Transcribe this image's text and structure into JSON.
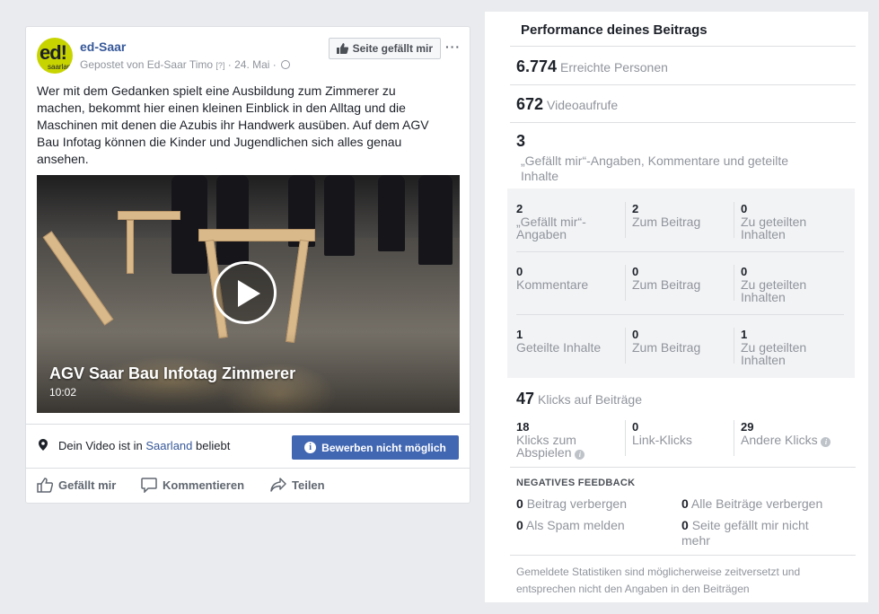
{
  "post": {
    "page_name": "ed-Saar",
    "avatar_text": "ed!",
    "avatar_sub": "saarland",
    "posted_by": "Gepostet von Ed-Saar Timo",
    "help_mark": "[?]",
    "date": "· 24. Mai ·",
    "like_page_button": "Seite gefällt mir",
    "more": "···",
    "text": "Wer mit dem Gedanken spielt eine Ausbildung zum Zimmerer zu machen, bekommt hier einen kleinen Einblick in den Alltag und die Maschinen mit denen die Azubis ihr Handwerk ausüben. Auf dem AGV Bau Infotag können die Kinder und Jugendlichen sich alles genau ansehen.",
    "video": {
      "title": "AGV Saar Bau Infotag Zimmerer",
      "duration": "10:02"
    },
    "promo": {
      "text_before": "Dein Video ist in",
      "highlight": "Saarland",
      "text_after": "beliebt",
      "button": "Bewerben nicht möglich"
    },
    "actions": {
      "like": "Gefällt mir",
      "comment": "Kommentieren",
      "share": "Teilen"
    }
  },
  "performance": {
    "title": "Performance deines Beitrags",
    "reach": {
      "value": "6.774",
      "label": "Erreichte Personen"
    },
    "views": {
      "value": "672",
      "label": "Videoaufrufe"
    },
    "reactions": {
      "value": "3",
      "label": "„Gefällt mir“-Angaben, Kommentare und geteilte Inhalte"
    },
    "grid": [
      [
        {
          "value": "2",
          "label": "„Gefällt mir“-Angaben"
        },
        {
          "value": "2",
          "label": "Zum Beitrag"
        },
        {
          "value": "0",
          "label": "Zu geteilten Inhalten"
        }
      ],
      [
        {
          "value": "0",
          "label": "Kommentare"
        },
        {
          "value": "0",
          "label": "Zum Beitrag"
        },
        {
          "value": "0",
          "label": "Zu geteilten Inhalten"
        }
      ],
      [
        {
          "value": "1",
          "label": "Geteilte Inhalte"
        },
        {
          "value": "0",
          "label": "Zum Beitrag"
        },
        {
          "value": "1",
          "label": "Zu geteilten Inhalten"
        }
      ]
    ],
    "clicks": {
      "value": "47",
      "label": "Klicks auf Beiträge"
    },
    "click_breakdown": [
      {
        "value": "18",
        "label": "Klicks zum Abspielen"
      },
      {
        "value": "0",
        "label": "Link-Klicks"
      },
      {
        "value": "29",
        "label": "Andere Klicks"
      }
    ],
    "negative_feedback": {
      "heading": "NEGATIVES FEEDBACK",
      "items": [
        {
          "value": "0",
          "label": "Beitrag verbergen"
        },
        {
          "value": "0",
          "label": "Alle Beiträge verbergen"
        },
        {
          "value": "0",
          "label": "Als Spam melden"
        },
        {
          "value": "0",
          "label": "Seite gefällt mir nicht mehr"
        }
      ]
    },
    "footnote": "Gemeldete Statistiken sind möglicherweise zeitversetzt und entsprechen nicht den Angaben in den Beiträgen"
  },
  "colors": {
    "link": "#365899",
    "button": "#4267b2",
    "muted": "#90949c",
    "avatar": "#c8d400"
  }
}
